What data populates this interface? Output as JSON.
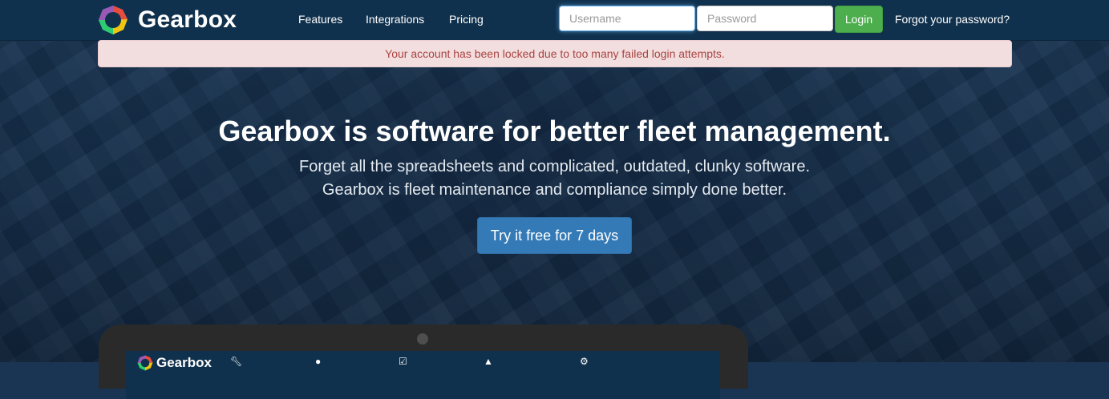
{
  "navbar": {
    "brand": "Gearbox",
    "links": [
      "Features",
      "Integrations",
      "Pricing"
    ],
    "username_placeholder": "Username",
    "password_placeholder": "Password",
    "login_label": "Login",
    "forgot_label": "Forgot your password?"
  },
  "alert": {
    "message": "Your account has been locked due to too many failed login attempts."
  },
  "hero": {
    "title": "Gearbox is software for better fleet management.",
    "subtitle_line1": "Forget all the spreadsheets and complicated, outdated, clunky software.",
    "subtitle_line2": "Gearbox is fleet maintenance and compliance simply done better.",
    "cta_label": "Try it free for 7 days"
  },
  "preview": {
    "brand": "Gearbox",
    "nav_icons": [
      "wrench-icon",
      "map-marker-icon",
      "checkbox-icon",
      "box-icon",
      "gear-icon"
    ]
  },
  "colors": {
    "navbar_bg": "#10314d",
    "alert_bg": "#f2dede",
    "alert_text": "#a94442",
    "login_green": "#4cae4c",
    "cta_blue": "#337ab7"
  }
}
